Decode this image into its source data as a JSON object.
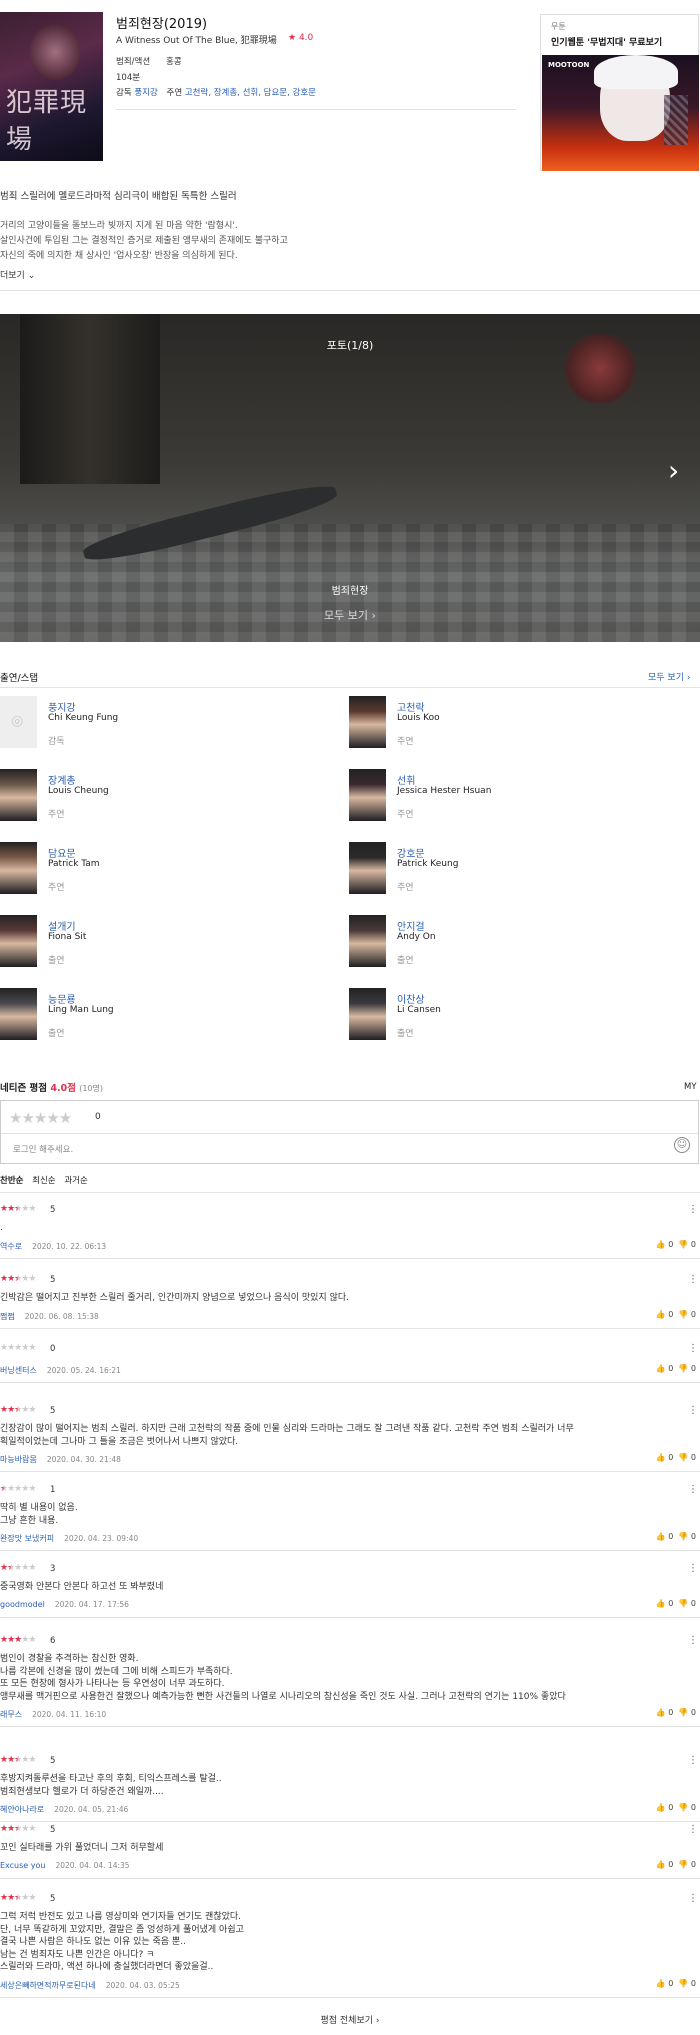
{
  "movie": {
    "title": "범죄현장(2019)",
    "subtitle": "A Witness Out Of The Blue, 犯罪現場",
    "rating": "4.0",
    "genre": "범죄/액션",
    "country": "홍콩",
    "runtime": "104분",
    "director_label": "감독",
    "director": "풍지강",
    "cast_label": "주연",
    "cast": "고천락, 장계총, 선휘, 담요문, 강호문",
    "poster_title": "犯罪現場",
    "logline": "범죄 스릴러에 멜로드라마적 심리극이 배합된 독특한 스릴러",
    "synopsis": [
      "거리의 고양이들을 돌보느라 빚까지 지게 된 마음 약한 '람형시'.",
      "살인사건에 투입된 그는 결정적인 증거로 제출된 앵무새의 존재에도 불구하고",
      "자신의 죽에 의지한 채 상사인 '업사오창' 반장을 의심하게 된다."
    ],
    "more": "더보기"
  },
  "ad": {
    "label": "무툰",
    "headline": "인기웹툰 '무법지대' 무료보기",
    "brand": "MOOTOON"
  },
  "photo": {
    "counter": "포토(1/8)",
    "name": "범죄현장",
    "view_all": "모두 보기"
  },
  "cast_section": {
    "title": "출연/스탭",
    "more": "모두 보기"
  },
  "cast": [
    {
      "kr": "풍지강",
      "en": "Chi Keung Fung",
      "role": "감독"
    },
    {
      "kr": "고천락",
      "en": "Louis Koo",
      "role": "주연"
    },
    {
      "kr": "장계총",
      "en": "Louis Cheung",
      "role": "주연"
    },
    {
      "kr": "선휘",
      "en": "Jessica Hester Hsuan",
      "role": "주연"
    },
    {
      "kr": "담요문",
      "en": "Patrick Tam",
      "role": "주연"
    },
    {
      "kr": "강호문",
      "en": "Patrick Keung",
      "role": "주연"
    },
    {
      "kr": "설개기",
      "en": "Fiona Sit",
      "role": "출연"
    },
    {
      "kr": "안지걸",
      "en": "Andy On",
      "role": "출연"
    },
    {
      "kr": "능문룡",
      "en": "Ling Man Lung",
      "role": "출연"
    },
    {
      "kr": "이찬상",
      "en": "Li Cansen",
      "role": "출연"
    }
  ],
  "netizen": {
    "title": "네티즌 평점",
    "score": "4.0점",
    "count": "(10명)",
    "my": "MY",
    "input_score": "0",
    "placeholder": "로그인 해주세요.",
    "sort": [
      "찬반순",
      "최신순",
      "과거순"
    ]
  },
  "reviews": [
    {
      "score": "5",
      "stars": 2.5,
      "text": ".",
      "author": "역수로",
      "date": "2020. 10. 22. 06:13",
      "up": "0",
      "down": "0"
    },
    {
      "score": "5",
      "stars": 2.5,
      "text": "긴박감은 떨어지고 진부한 스릴러 줄거리, 인간미까지 양념으로 넣었으나 음식이 맛있지 않다.",
      "author": "쩜쩜",
      "date": "2020. 06. 08. 15:38",
      "up": "0",
      "down": "0"
    },
    {
      "score": "0",
      "stars": 0,
      "text": "",
      "author": "버닝센터스",
      "date": "2020. 05. 24. 16:21",
      "up": "0",
      "down": "0"
    },
    {
      "score": "5",
      "stars": 2.5,
      "text": "긴장감이 많이 떨어지는 범죄 스릴러. 하지만 근래 고천락의 작품 중에 인물 심리와 드라마는 그래도 잘 그려낸 작품 같다. 고천락 주연 범죄 스릴러가 너무\n획일적이었는데 그나마 그 틀을 조금은 벗어나서 나쁘지 않았다.",
      "author": "마능바람몸",
      "date": "2020. 04. 30. 21:48",
      "up": "0",
      "down": "0"
    },
    {
      "score": "1",
      "stars": 0.5,
      "text": "딱히 별 내용이 없음.\n그냥 흔한 내용.",
      "author": "완장맛 보냈커피",
      "date": "2020. 04. 23. 09:40",
      "up": "0",
      "down": "0"
    },
    {
      "score": "3",
      "stars": 1.5,
      "text": "중국영화 안본다 안본다 하고선 또 봐부렸네",
      "author": "goodmodel",
      "date": "2020. 04. 17. 17:56",
      "up": "0",
      "down": "0"
    },
    {
      "score": "6",
      "stars": 3,
      "text": "범인이 경찰을 추격하는 참신한 영화.\n나름 각본에 신경을 많이 썼는데 그에 비해 스피드가 부족하다.\n또 모든 현장에 형사가 나타나는 등 우연성이 너무 과도하다.\n앵무새를 맥거핀으로 사용한건 잘했으나 예측가능한 뻔한 사건들의 나열로 시나리오의 참신성을 죽인 것도 사실. 그러나 고천락의 연기는 110% 좋았다",
      "author": "래무스",
      "date": "2020. 04. 11. 16:10",
      "up": "0",
      "down": "0"
    },
    {
      "score": "5",
      "stars": 2.5,
      "text": "후방지켜돌루션을 타고난 후의 후회, 티익스프레스를 탈걸..\n범죄현생보다 헬로가 더 하당준건 왜일까....",
      "author": "혜얀아나라로",
      "date": "2020. 04. 05. 21:46",
      "up": "0",
      "down": "0"
    },
    {
      "score": "5",
      "stars": 2.5,
      "text": "꼬인 실타래를 가위 풀었더니 그저 허무할세",
      "author": "Excuse you",
      "date": "2020. 04. 04. 14:35",
      "up": "0",
      "down": "0"
    },
    {
      "score": "5",
      "stars": 2.5,
      "text": "그럭 저럭 반전도 있고 나름 영상미와 연기자들 연기도 괜찮았다.\n단, 너무 똑같하게 꼬았지만, 결말은 좀 엉성하게 풀어냈게 아쉽고\n결국 나쁜 사람은 하나도 없는 이유 있는 죽음 뿐..\n남는 건 범죄자도 나쁜 인간은 아니다? ㅋ\n스릴러와 드라마, 액션 하나에 충실했더라면더 좋았을걸..",
      "author": "세상은빼하면적까무로된다네",
      "date": "2020. 04. 03. 05:25",
      "up": "0",
      "down": "0"
    }
  ],
  "footer": {
    "all_reviews": "평점 전체보기"
  }
}
